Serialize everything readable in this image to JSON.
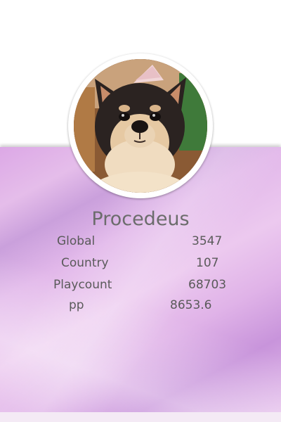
{
  "profile": {
    "username": "Procedeus"
  },
  "stats": {
    "global": {
      "label": "Global",
      "value": "3547"
    },
    "country": {
      "label": "Country",
      "value": "107"
    },
    "playcount": {
      "label": "Playcount",
      "value": "68703"
    },
    "pp": {
      "label": "pp",
      "value": "8653.6"
    }
  },
  "colors": {
    "panel_accent": "#d9a8e6",
    "text": "#5a5a5a"
  }
}
